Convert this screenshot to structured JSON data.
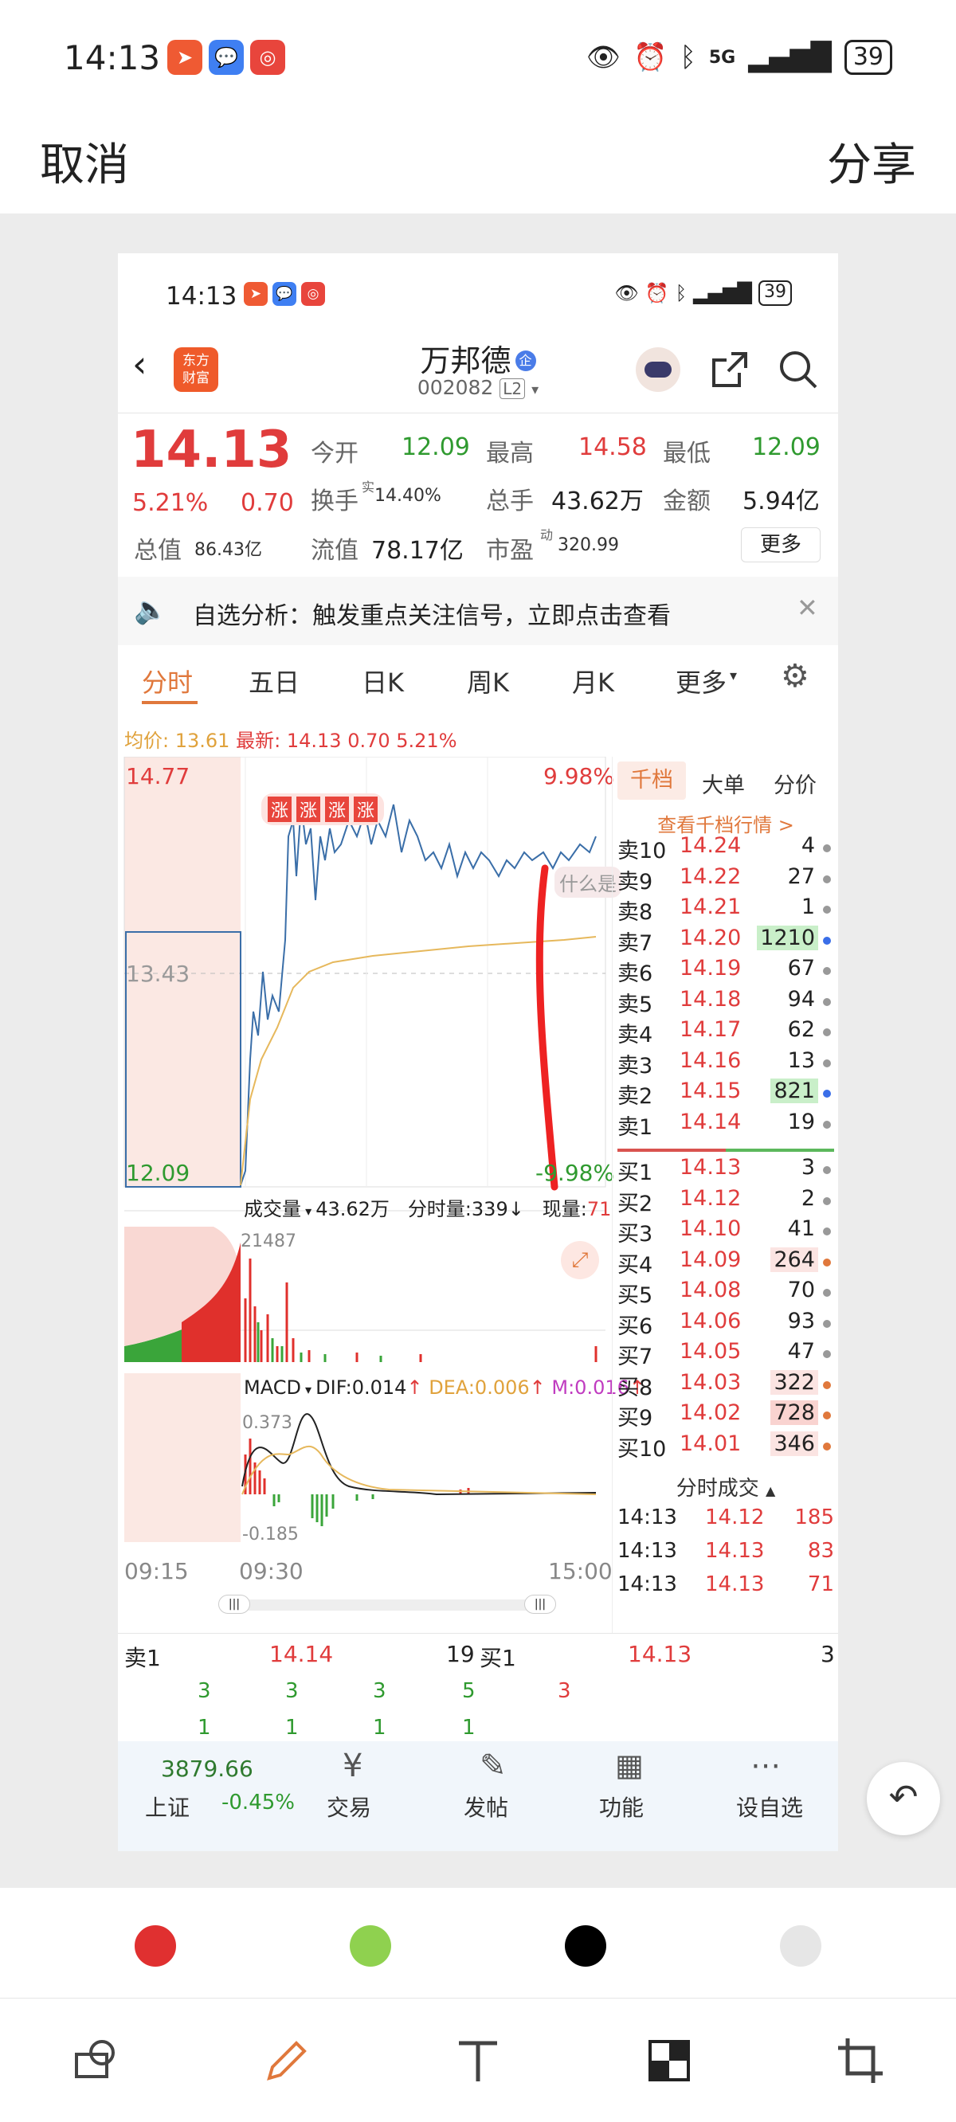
{
  "status_bar": {
    "time": "14:13",
    "battery": "39",
    "network": "5G"
  },
  "header": {
    "cancel": "取消",
    "share": "分享"
  },
  "shot": {
    "status": {
      "time": "14:13",
      "battery": "39"
    },
    "app_logo": "东方\n财富",
    "stock_name": "万邦德",
    "stock_badge": "企",
    "stock_code": "002082",
    "level": "L2",
    "quote": {
      "price": "14.13",
      "change_pct": "5.21%",
      "change": "0.70",
      "open_label": "今开",
      "open": "12.09",
      "high_label": "最高",
      "high": "14.58",
      "low_label": "最低",
      "low": "12.09",
      "turnover_label": "换手",
      "turnover_sup": "实",
      "turnover": "14.40%",
      "volume_label": "总手",
      "volume": "43.62万",
      "amount_label": "金额",
      "amount": "5.94亿",
      "mcap_label": "总值",
      "mcap": "86.43亿",
      "float_label": "流值",
      "float": "78.17亿",
      "pe_label": "市盈",
      "pe_sup": "动",
      "pe": "320.99",
      "more": "更多"
    },
    "notice": "自选分析：触发重点关注信号，立即点击查看",
    "tabs": [
      "分时",
      "五日",
      "日K",
      "周K",
      "月K",
      "更多"
    ],
    "avg_line": {
      "avg_label": "均价:",
      "avg": "13.61",
      "latest_label": "最新:",
      "latest": "14.13",
      "chg": "0.70",
      "pct": "5.21%"
    },
    "chart_labels": {
      "top": "14.77",
      "mid": "13.43",
      "bottom": "12.09",
      "top_pct": "9.98%",
      "bottom_pct": "-9.98%",
      "bubble": "什么是",
      "zhang": "涨"
    },
    "volume_bar": {
      "label": "成交量",
      "total": "43.62万",
      "tick_label": "分时量:",
      "tick": "339",
      "now_label": "现量:",
      "now": "71",
      "max": "21487"
    },
    "macd": {
      "label": "MACD",
      "dif": "DIF:0.014",
      "dea": "DEA:0.006",
      "m": "M:0.016",
      "top": "0.373",
      "bottom": "-0.185"
    },
    "time_axis": [
      "09:15",
      "09:30",
      "15:00"
    ],
    "ob_tabs": [
      "千档",
      "大单",
      "分价"
    ],
    "ob_link": "查看千档行情 >",
    "asks": [
      {
        "l": "卖10",
        "p": "14.24",
        "q": "4"
      },
      {
        "l": "卖9",
        "p": "14.22",
        "q": "27"
      },
      {
        "l": "卖8",
        "p": "14.21",
        "q": "1"
      },
      {
        "l": "卖7",
        "p": "14.20",
        "q": "1210"
      },
      {
        "l": "卖6",
        "p": "14.19",
        "q": "67"
      },
      {
        "l": "卖5",
        "p": "14.18",
        "q": "94"
      },
      {
        "l": "卖4",
        "p": "14.17",
        "q": "62"
      },
      {
        "l": "卖3",
        "p": "14.16",
        "q": "13"
      },
      {
        "l": "卖2",
        "p": "14.15",
        "q": "821"
      },
      {
        "l": "卖1",
        "p": "14.14",
        "q": "19"
      }
    ],
    "bids": [
      {
        "l": "买1",
        "p": "14.13",
        "q": "3"
      },
      {
        "l": "买2",
        "p": "14.12",
        "q": "2"
      },
      {
        "l": "买3",
        "p": "14.10",
        "q": "41"
      },
      {
        "l": "买4",
        "p": "14.09",
        "q": "264"
      },
      {
        "l": "买5",
        "p": "14.08",
        "q": "70"
      },
      {
        "l": "买6",
        "p": "14.06",
        "q": "93"
      },
      {
        "l": "买7",
        "p": "14.05",
        "q": "47"
      },
      {
        "l": "买8",
        "p": "14.03",
        "q": "322"
      },
      {
        "l": "买9",
        "p": "14.02",
        "q": "728"
      },
      {
        "l": "买10",
        "p": "14.01",
        "q": "346"
      }
    ],
    "trades_title": "分时成交",
    "trades": [
      {
        "t": "14:13",
        "p": "14.12",
        "q": "185"
      },
      {
        "t": "14:13",
        "p": "14.13",
        "q": "83"
      },
      {
        "t": "14:13",
        "p": "14.13",
        "q": "71"
      }
    ],
    "bottom_book": {
      "sell_label": "卖1",
      "sell_price": "14.14",
      "sell_qty": "19",
      "buy_label": "买1",
      "buy_price": "14.13",
      "buy_qty": "3",
      "row1": [
        "3",
        "3",
        "3",
        "5",
        "3"
      ],
      "row2": [
        "1",
        "1",
        "1",
        "1"
      ]
    },
    "index": {
      "value": "3879.66",
      "name": "上证",
      "chg": "-0.45%"
    },
    "nav": [
      "交易",
      "发帖",
      "功能",
      "设自选"
    ]
  },
  "palette": [
    "#e03030",
    "#8fd14f",
    "#000000",
    "#e6e6e6"
  ]
}
